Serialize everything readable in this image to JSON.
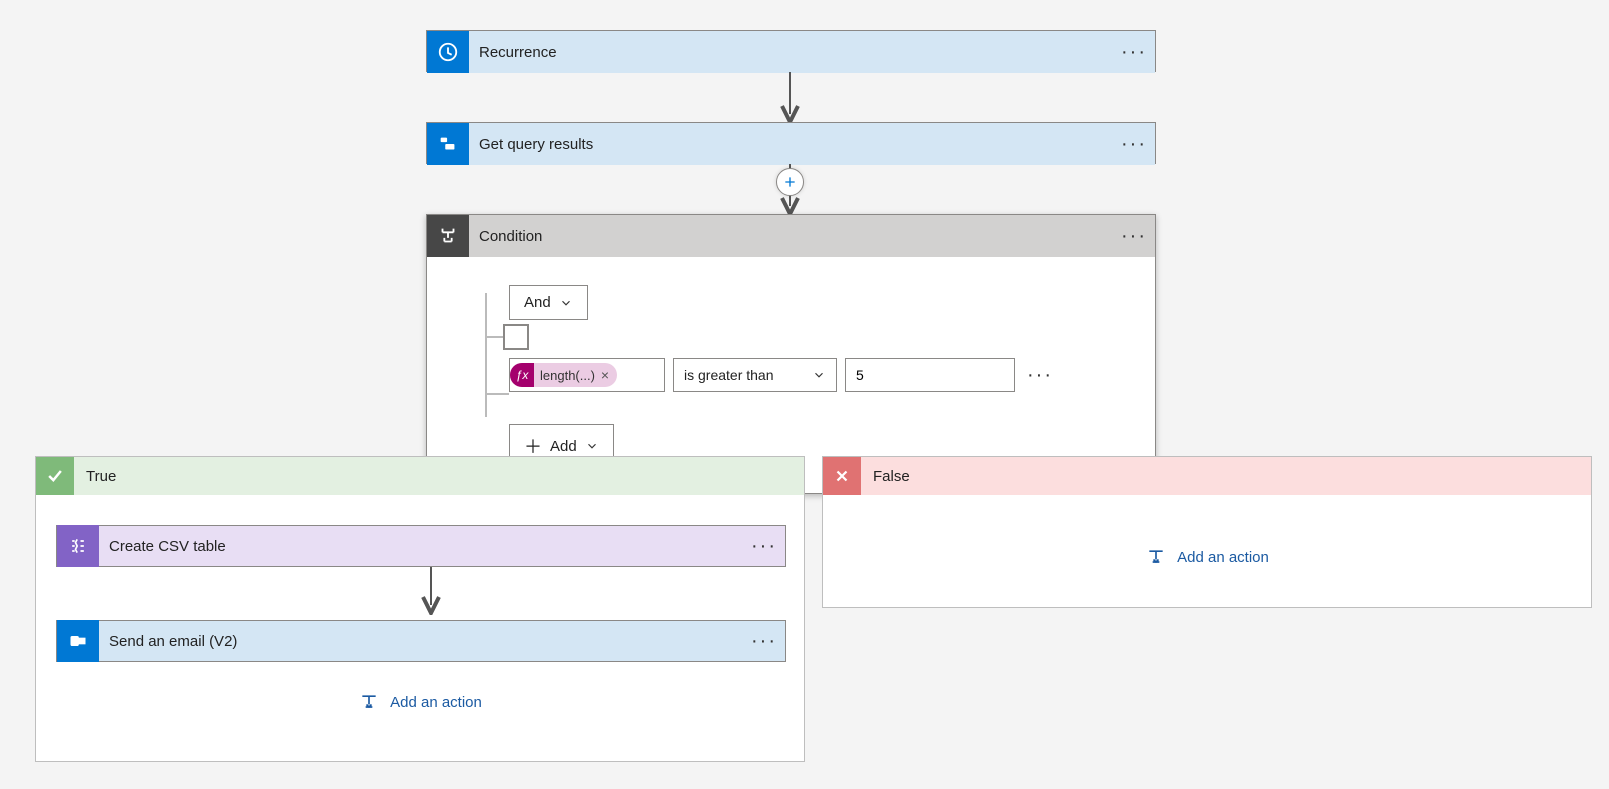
{
  "steps": {
    "recurrence": {
      "title": "Recurrence"
    },
    "query": {
      "title": "Get query results"
    },
    "condition": {
      "title": "Condition"
    },
    "csv": {
      "title": "Create CSV table"
    },
    "email": {
      "title": "Send an email (V2)"
    }
  },
  "condition": {
    "group_operator": "And",
    "add_label": "Add",
    "rows": [
      {
        "expression": "length(...)",
        "operator": "is greater than",
        "value": "5"
      }
    ]
  },
  "branches": {
    "true": {
      "label": "True",
      "add_action_label": "Add an action"
    },
    "false": {
      "label": "False",
      "add_action_label": "Add an action"
    }
  }
}
